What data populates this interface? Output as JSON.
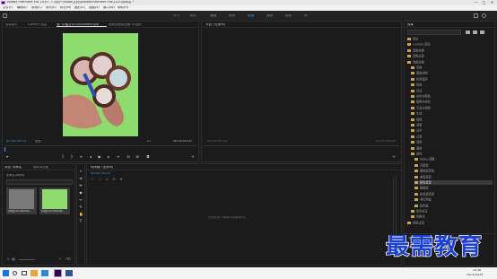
{
  "window": {
    "title": "Adobe Premiere Pro 2020 - C:\\用户\\lolleo\\文档\\Adobe\\Premiere Pro\\14.0\\未命名 *",
    "controls": [
      "—",
      "□",
      "✕"
    ]
  },
  "menubar": {
    "items": [
      "文件(F)",
      "编辑(E)",
      "剪辑(C)",
      "序列(S)",
      "标记(M)",
      "图形(G)",
      "视图(V)",
      "窗口(W)",
      "帮助(H)"
    ]
  },
  "workspace": {
    "tabs": [
      "学习",
      "组件",
      "编辑",
      "颜色",
      "效果",
      "音频",
      "图形",
      "库"
    ],
    "active_index": 4
  },
  "source_monitor": {
    "tabs": [
      "效果控件",
      "Lumetri 范围",
      "源: 02图片01100000e49.jpg",
      "音频剪辑混合器: 02图片"
    ],
    "timecode_left": "00:00:00:00",
    "fit": "适合",
    "ratio": "1/2",
    "timecode_right": "00:00:05:00"
  },
  "program_monitor": {
    "title": "节目: (无序列)",
    "timecode_left": "00:00:00:00",
    "timecode_right": "00:00:00:00"
  },
  "project_panel": {
    "tabs": [
      "项目: 未命名",
      "媒体浏览器"
    ],
    "file": "未命名.prproj",
    "items": [
      {
        "label": "02图片01000000..."
      },
      {
        "label": "02图片01000000..."
      }
    ]
  },
  "timeline": {
    "title": "时间轴: (无序列)",
    "timecode": "00:00:00:00",
    "placeholder": "在此处放下媒体以创建序列。"
  },
  "effects_panel": {
    "title": "效果",
    "items": [
      {
        "label": "预设",
        "indent": 0
      },
      {
        "label": "Lumetri 预设",
        "indent": 0
      },
      {
        "label": "音频效果",
        "indent": 0
      },
      {
        "label": "音频过渡",
        "indent": 0
      },
      {
        "label": "视频效果",
        "indent": 0
      },
      {
        "label": "变换",
        "indent": 1
      },
      {
        "label": "图像控制",
        "indent": 1
      },
      {
        "label": "实用程序",
        "indent": 1
      },
      {
        "label": "扭曲",
        "indent": 1
      },
      {
        "label": "时间",
        "indent": 1
      },
      {
        "label": "杂色与颗粒",
        "indent": 1
      },
      {
        "label": "模糊与锐化",
        "indent": 1
      },
      {
        "label": "沉浸式视频",
        "indent": 1
      },
      {
        "label": "生成",
        "indent": 1
      },
      {
        "label": "视频",
        "indent": 1
      },
      {
        "label": "调整",
        "indent": 1
      },
      {
        "label": "过时",
        "indent": 1
      },
      {
        "label": "过渡",
        "indent": 1
      },
      {
        "label": "透视",
        "indent": 1
      },
      {
        "label": "通道",
        "indent": 1
      },
      {
        "label": "键控",
        "indent": 1
      },
      {
        "label": "Alpha 调整",
        "indent": 2
      },
      {
        "label": "亮度键",
        "indent": 2
      },
      {
        "label": "图像遮罩键",
        "indent": 2
      },
      {
        "label": "差值遮罩",
        "indent": 2
      },
      {
        "label": "移除遮罩",
        "indent": 2
      },
      {
        "label": "超级键",
        "indent": 2
      },
      {
        "label": "轨道遮罩键",
        "indent": 2
      },
      {
        "label": "非红色键",
        "indent": 2
      },
      {
        "label": "颜色键",
        "indent": 2
      },
      {
        "label": "颜色校正",
        "indent": 1
      },
      {
        "label": "风格化",
        "indent": 1
      },
      {
        "label": "视频过渡",
        "indent": 0
      }
    ],
    "selected_index": 25,
    "bottom_items": [
      "基本图形",
      "基本声音",
      "Lumetri 颜色"
    ]
  },
  "taskbar": {
    "time": "15:16",
    "date": "2021/10/24"
  },
  "watermark": "最需教育",
  "colors": {
    "accent": "#4a9bff",
    "bg": "#1d1d1d",
    "panel": "#1b1b1b"
  }
}
